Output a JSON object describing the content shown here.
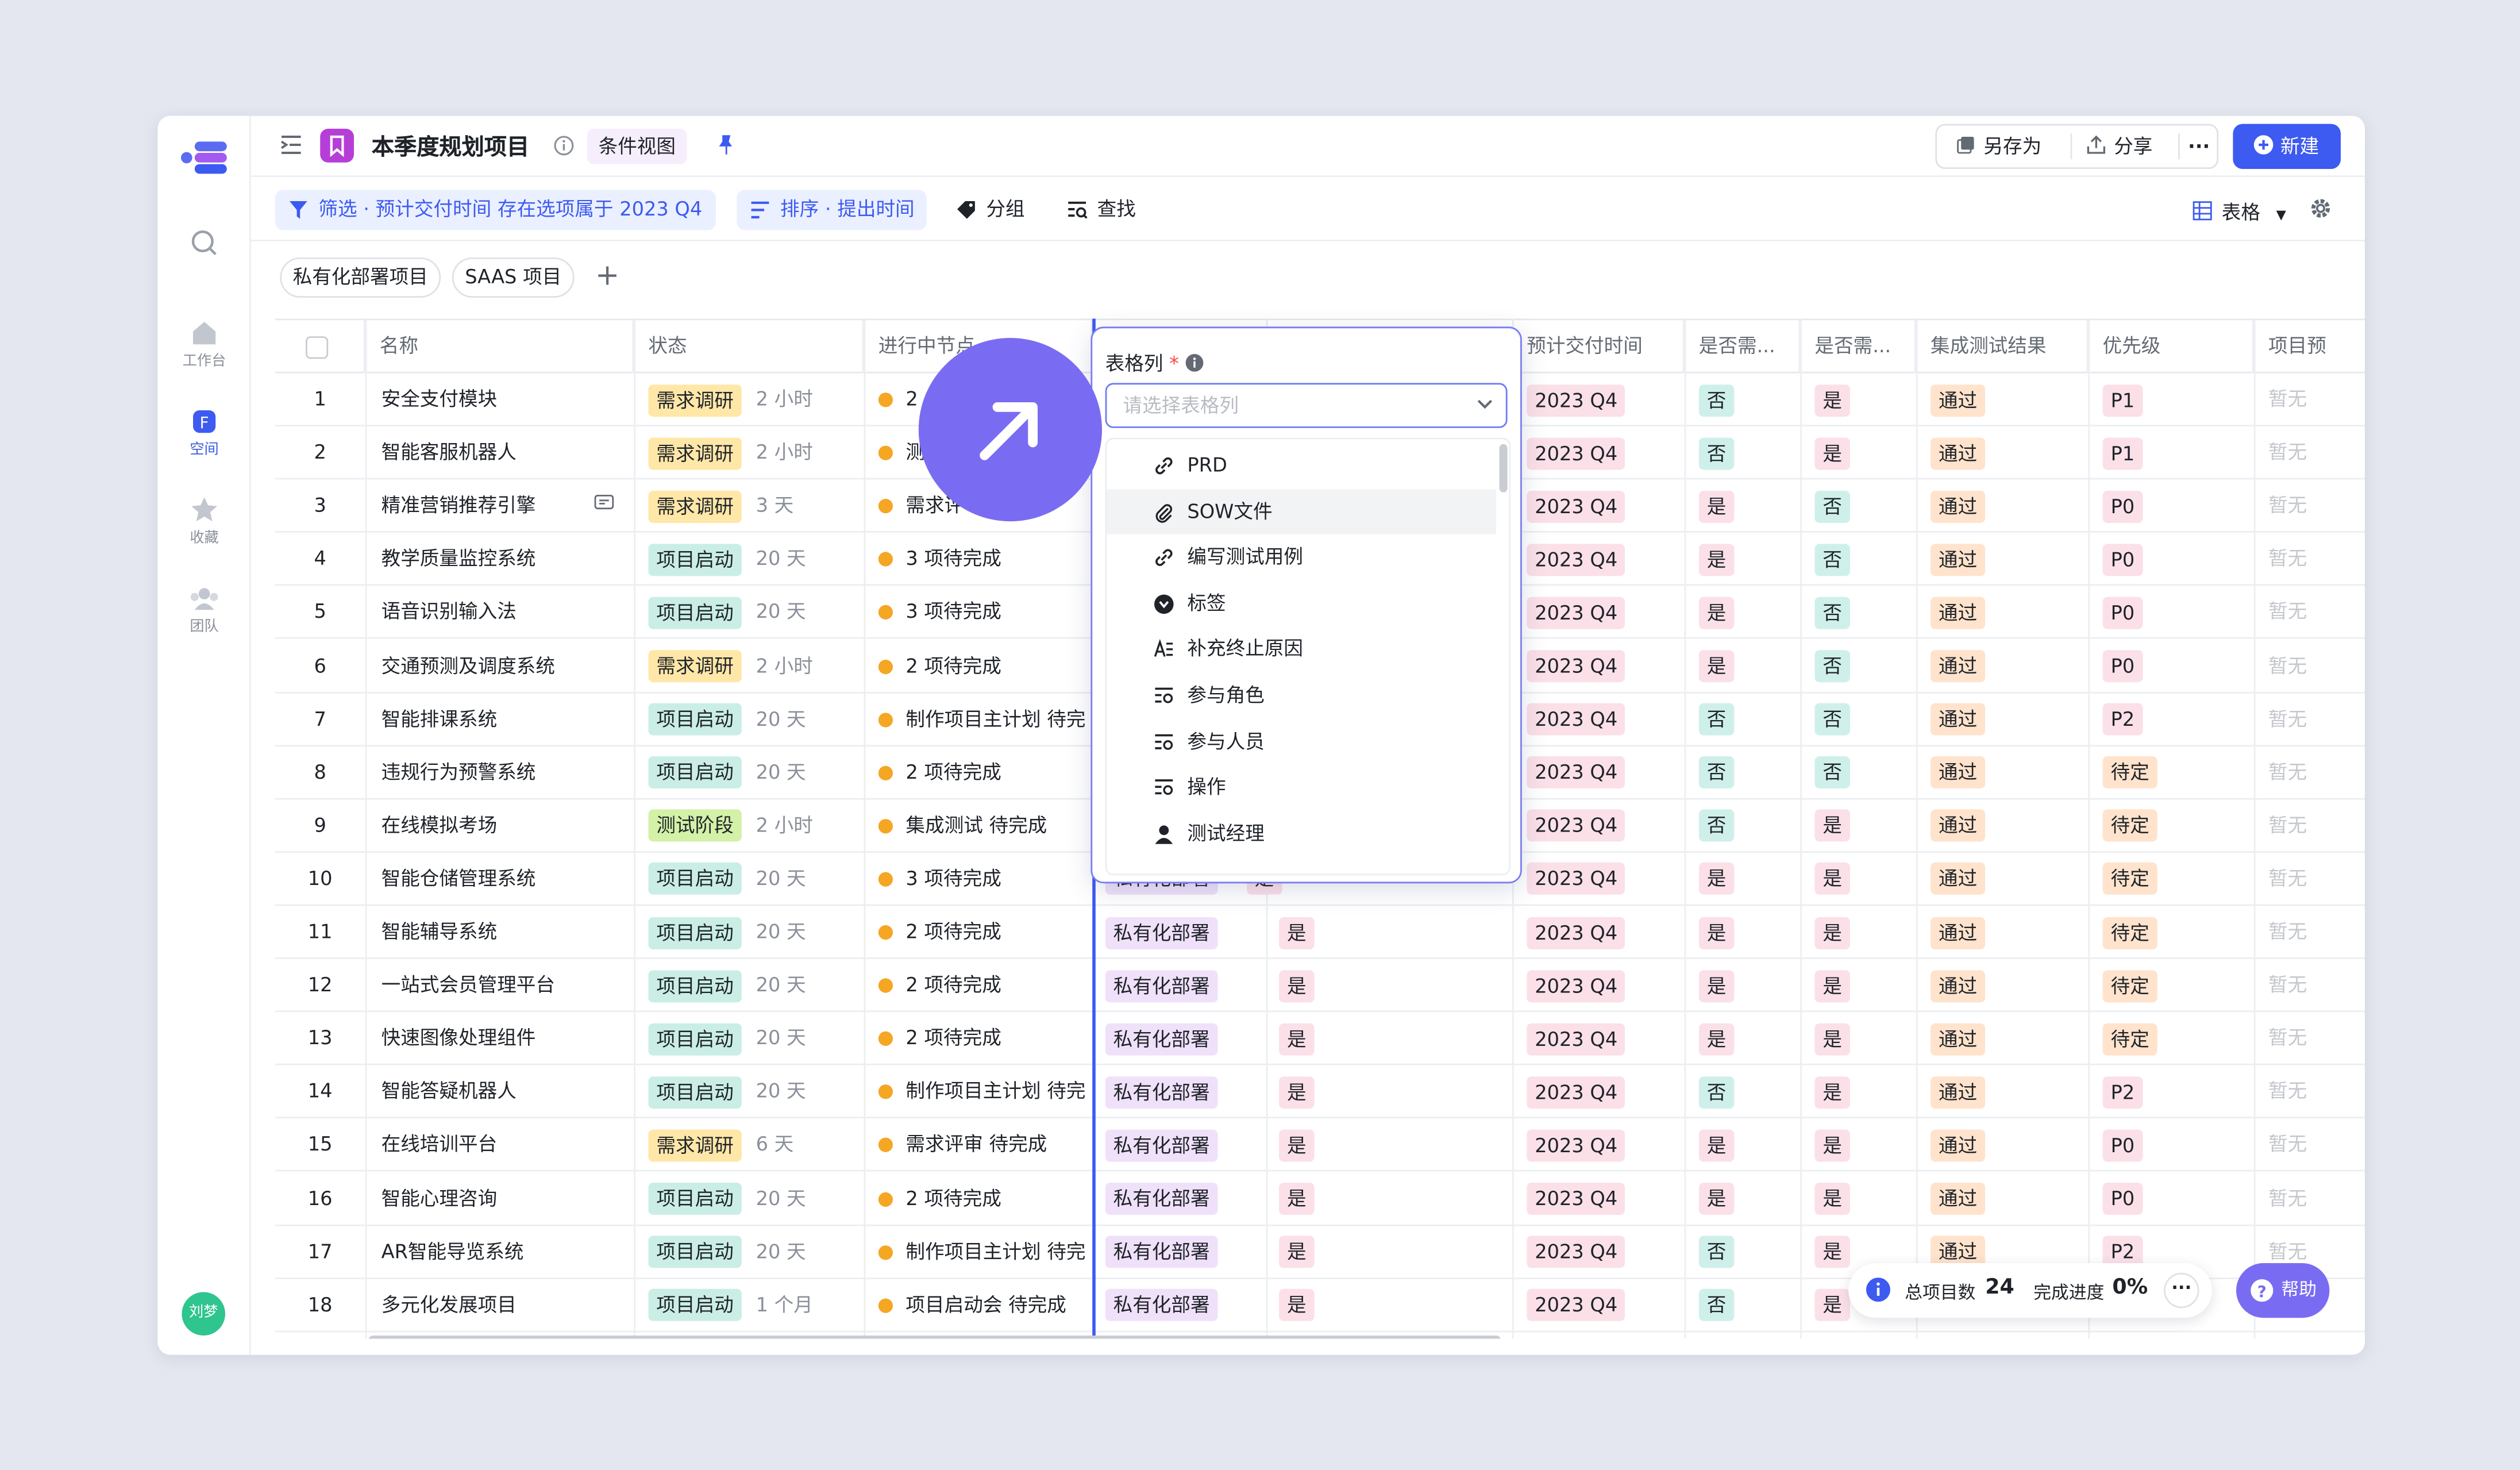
{
  "app": {
    "title": "本季度规划项目",
    "view_tag": "条件视图",
    "save_as": "另存为",
    "share": "分享",
    "more": "···",
    "new_button": "新建"
  },
  "rail": [
    {
      "label": "工作台",
      "icon": "home-icon"
    },
    {
      "label": "空间",
      "icon": "space-icon",
      "active": true
    },
    {
      "label": "收藏",
      "icon": "star-icon"
    },
    {
      "label": "团队",
      "icon": "team-icon"
    }
  ],
  "user": {
    "avatar_text": "刘梦"
  },
  "toolbar": {
    "filter": "筛选 · 预计交付时间 存在选项属于 2023 Q4",
    "sort": "排序 · 提出时间",
    "group": "分组",
    "find": "查找",
    "view_type": "表格"
  },
  "tabs": [
    "私有化部署项目",
    "SAAS 项目"
  ],
  "columns": [
    "名称",
    "状态",
    "进行中节点",
    "预计交付时间",
    "是否需...",
    "是否需...",
    "集成测试结果",
    "优先级",
    "项目预"
  ],
  "rows": [
    {
      "n": "1",
      "name": "安全支付模块",
      "status": "需求调研",
      "st": "y",
      "dur": "2 小时",
      "node": "2",
      "deploy": "",
      "flag": "",
      "q": "2023 Q4",
      "a": "否",
      "b": "是",
      "test": "通过",
      "pri": "P1",
      "pre": "暂无"
    },
    {
      "n": "2",
      "name": "智能客服机器人",
      "status": "需求调研",
      "st": "y",
      "dur": "2 小时",
      "node": "测",
      "deploy": "",
      "flag": "",
      "q": "2023 Q4",
      "a": "否",
      "b": "是",
      "test": "通过",
      "pri": "P1",
      "pre": "暂无"
    },
    {
      "n": "3",
      "name": "精准营销推荐引擎",
      "status": "需求调研",
      "st": "y",
      "dur": "3 天",
      "node": "需求评",
      "deploy": "",
      "flag": "",
      "q": "2023 Q4",
      "a": "是",
      "b": "否",
      "test": "通过",
      "pri": "P0",
      "pre": "暂无",
      "comment": true
    },
    {
      "n": "4",
      "name": "教学质量监控系统",
      "status": "项目启动",
      "st": "g",
      "dur": "20 天",
      "node": "3 项待完成",
      "deploy": "",
      "flag": "",
      "q": "2023 Q4",
      "a": "是",
      "b": "否",
      "test": "通过",
      "pri": "P0",
      "pre": "暂无"
    },
    {
      "n": "5",
      "name": "语音识别输入法",
      "status": "项目启动",
      "st": "g",
      "dur": "20 天",
      "node": "3 项待完成",
      "deploy": "",
      "flag": "",
      "q": "2023 Q4",
      "a": "是",
      "b": "否",
      "test": "通过",
      "pri": "P0",
      "pre": "暂无"
    },
    {
      "n": "6",
      "name": "交通预测及调度系统",
      "status": "需求调研",
      "st": "y",
      "dur": "2 小时",
      "node": "2 项待完成",
      "deploy": "",
      "flag": "",
      "q": "2023 Q4",
      "a": "是",
      "b": "否",
      "test": "通过",
      "pri": "P0",
      "pre": "暂无"
    },
    {
      "n": "7",
      "name": "智能排课系统",
      "status": "项目启动",
      "st": "g",
      "dur": "20 天",
      "node": "制作项目主计划 待完",
      "deploy": "",
      "flag": "",
      "q": "2023 Q4",
      "a": "否",
      "b": "否",
      "test": "通过",
      "pri": "P2",
      "pre": "暂无"
    },
    {
      "n": "8",
      "name": "违规行为预警系统",
      "status": "项目启动",
      "st": "g",
      "dur": "20 天",
      "node": "2 项待完成",
      "deploy": "",
      "flag": "",
      "q": "2023 Q4",
      "a": "否",
      "b": "否",
      "test": "通过",
      "pri": "待定",
      "pre": "暂无"
    },
    {
      "n": "9",
      "name": "在线模拟考场",
      "status": "测试阶段",
      "st": "l",
      "dur": "2 小时",
      "node": "集成测试 待完成",
      "deploy": "",
      "flag": "",
      "q": "2023 Q4",
      "a": "否",
      "b": "是",
      "test": "通过",
      "pri": "待定",
      "pre": "暂无"
    },
    {
      "n": "10",
      "name": "智能仓储管理系统",
      "status": "项目启动",
      "st": "g",
      "dur": "20 天",
      "node": "3 项待完成",
      "deploy": "",
      "flag": "",
      "q": "2023 Q4",
      "a": "是",
      "b": "是",
      "test": "通过",
      "pri": "待定",
      "pre": "暂无"
    },
    {
      "n": "11",
      "name": "智能辅导系统",
      "status": "项目启动",
      "st": "g",
      "dur": "20 天",
      "node": "2 项待完成",
      "deploy": "私有化部署",
      "flag": "是",
      "q": "2023 Q4",
      "a": "是",
      "b": "是",
      "test": "通过",
      "pri": "待定",
      "pre": "暂无"
    },
    {
      "n": "12",
      "name": "一站式会员管理平台",
      "status": "项目启动",
      "st": "g",
      "dur": "20 天",
      "node": "2 项待完成",
      "deploy": "私有化部署",
      "flag": "是",
      "q": "2023 Q4",
      "a": "是",
      "b": "是",
      "test": "通过",
      "pri": "待定",
      "pre": "暂无"
    },
    {
      "n": "13",
      "name": "快速图像处理组件",
      "status": "项目启动",
      "st": "g",
      "dur": "20 天",
      "node": "2 项待完成",
      "deploy": "私有化部署",
      "flag": "是",
      "q": "2023 Q4",
      "a": "是",
      "b": "是",
      "test": "通过",
      "pri": "待定",
      "pre": "暂无"
    },
    {
      "n": "14",
      "name": "智能答疑机器人",
      "status": "项目启动",
      "st": "g",
      "dur": "20 天",
      "node": "制作项目主计划 待完",
      "deploy": "私有化部署",
      "flag": "是",
      "q": "2023 Q4",
      "a": "否",
      "b": "是",
      "test": "通过",
      "pri": "P2",
      "pre": "暂无"
    },
    {
      "n": "15",
      "name": "在线培训平台",
      "status": "需求调研",
      "st": "y",
      "dur": "6 天",
      "node": "需求评审 待完成",
      "deploy": "私有化部署",
      "flag": "是",
      "q": "2023 Q4",
      "a": "是",
      "b": "是",
      "test": "通过",
      "pri": "P0",
      "pre": "暂无"
    },
    {
      "n": "16",
      "name": "智能心理咨询",
      "status": "项目启动",
      "st": "g",
      "dur": "20 天",
      "node": "2 项待完成",
      "deploy": "私有化部署",
      "flag": "是",
      "q": "2023 Q4",
      "a": "是",
      "b": "是",
      "test": "通过",
      "pri": "P0",
      "pre": "暂无"
    },
    {
      "n": "17",
      "name": "AR智能导览系统",
      "status": "项目启动",
      "st": "g",
      "dur": "20 天",
      "node": "制作项目主计划 待完",
      "deploy": "私有化部署",
      "flag": "是",
      "q": "2023 Q4",
      "a": "否",
      "b": "是",
      "test": "通过",
      "pri": "P2",
      "pre": "暂无"
    },
    {
      "n": "18",
      "name": "多元化发展项目",
      "status": "项目启动",
      "st": "g",
      "dur": "1 个月",
      "node": "项目启动会 待完成",
      "deploy": "私有化部署",
      "flag": "是",
      "q": "2023 Q4",
      "a": "否",
      "b": "是",
      "test": "",
      "pri": "",
      "pre": ""
    }
  ],
  "partial_row_10": {
    "deploy": "私有化部署",
    "flag": "是"
  },
  "popover": {
    "label": "表格列",
    "required": "*",
    "placeholder": "请选择表格列",
    "options": [
      {
        "label": "PRD",
        "icon": "link-icon"
      },
      {
        "label": "SOW文件",
        "icon": "paperclip-icon",
        "highlighted": true
      },
      {
        "label": "编写测试用例",
        "icon": "link-icon"
      },
      {
        "label": "标签",
        "icon": "tag-icon"
      },
      {
        "label": "补充终止原因",
        "icon": "text-icon"
      },
      {
        "label": "参与角色",
        "icon": "lookup-icon"
      },
      {
        "label": "参与人员",
        "icon": "lookup-icon"
      },
      {
        "label": "操作",
        "icon": "lookup-icon"
      },
      {
        "label": "测试经理",
        "icon": "person-icon"
      }
    ]
  },
  "status_bar": {
    "total_label": "总项目数",
    "total": "24",
    "progress_label": "完成进度",
    "progress": "0%",
    "help": "帮助"
  },
  "colors": {
    "accent": "#3d5af1",
    "purple": "#7a6cf2"
  }
}
